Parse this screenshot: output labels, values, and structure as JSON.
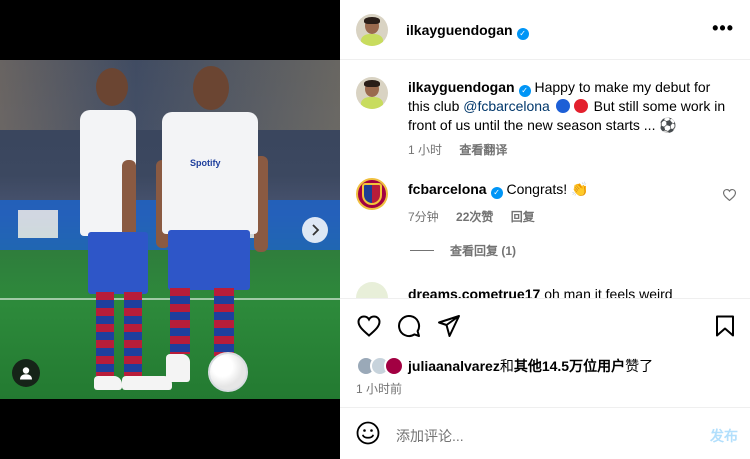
{
  "post": {
    "author": "ilkayguendogan",
    "more_icon": "more-horizontal-icon"
  },
  "caption": {
    "author": "ilkayguendogan",
    "text_1": "Happy to make my debut for this club",
    "mention": "@fcbarcelona",
    "text_2": "But still some work in front of us until the new season starts ...",
    "emoji": "⚽",
    "time": "1 小时",
    "translate": "查看翻译"
  },
  "comments": [
    {
      "author": "fcbarcelona",
      "text": "Congrats!",
      "emoji": "👏",
      "time": "7分钟",
      "likes": "22次赞",
      "reply": "回复",
      "view_replies": "查看回复 (1)"
    },
    {
      "author": "dreams.cometrue17",
      "text": "oh man it feels weird"
    }
  ],
  "actions": {
    "like_icon": "heart-icon",
    "comment_icon": "comment-icon",
    "share_icon": "send-icon",
    "save_icon": "bookmark-icon"
  },
  "likes": {
    "user": "juliaanalvarez",
    "joiner": "和",
    "others": "其他14.5万位用户",
    "suffix": "赞了"
  },
  "post_time": "1 小时前",
  "composer": {
    "placeholder": "添加评论...",
    "post_label": "发布"
  },
  "colors": {
    "link": "#00376b",
    "verified": "#0095f6",
    "muted": "#737373",
    "post_disabled": "#b2dffc"
  }
}
